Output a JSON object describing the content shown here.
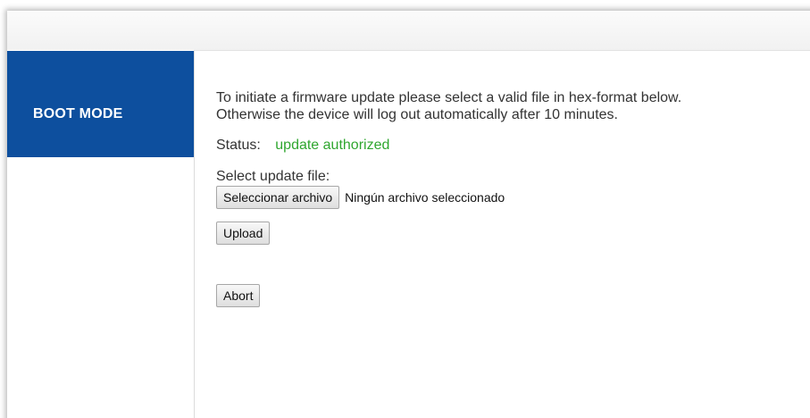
{
  "sidebar": {
    "items": [
      {
        "label": "BOOT MODE"
      }
    ]
  },
  "main": {
    "intro_line1": "To initiate a firmware update please select a valid file in hex-format below.",
    "intro_line2": "Otherwise the device will log out automatically after 10 minutes.",
    "status_label": "Status:",
    "status_value": "update authorized",
    "file_label": "Select update file:",
    "file_button_label": "Seleccionar archivo",
    "file_status": "Ningún archivo seleccionado",
    "upload_label": "Upload",
    "abort_label": "Abort"
  },
  "colors": {
    "nav_active": "#0d4f9e",
    "status_ok": "#2fa62f"
  }
}
